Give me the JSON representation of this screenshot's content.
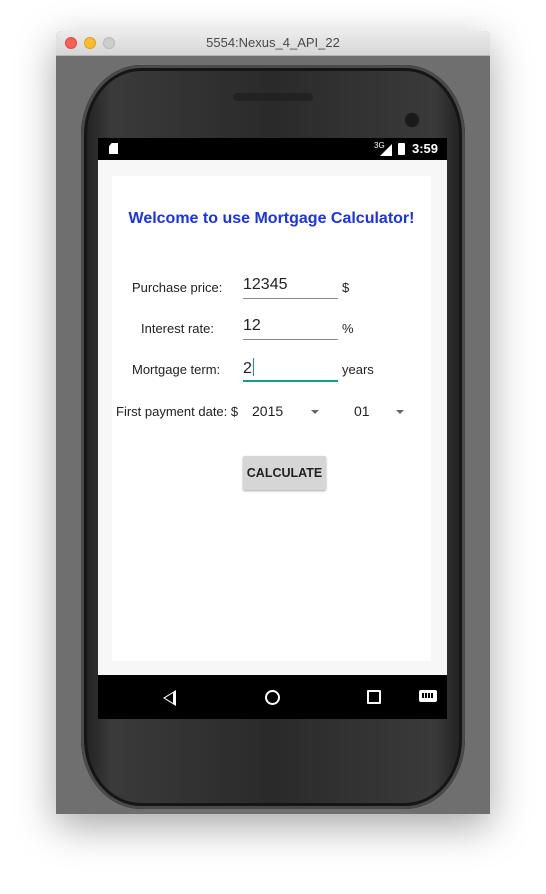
{
  "window": {
    "title": "5554:Nexus_4_API_22"
  },
  "statusbar": {
    "signal": "3G",
    "time": "3:59"
  },
  "app": {
    "heading": "Welcome to use Mortgage Calculator!",
    "purchase_price": {
      "label": "Purchase price:",
      "value": "12345",
      "unit": "$"
    },
    "interest_rate": {
      "label": "Interest rate:",
      "value": "12",
      "unit": "%"
    },
    "mortgage_term": {
      "label": "Mortgage term:",
      "value": "2",
      "unit": "years"
    },
    "first_payment": {
      "label": "First payment date: $",
      "year": "2015",
      "month": "01"
    },
    "calculate_label": "CALCULATE"
  },
  "navbar": {
    "icons": [
      "back-icon",
      "home-icon",
      "recents-icon",
      "keyboard-icon"
    ]
  },
  "colors": {
    "heading": "#1a33e8",
    "accent": "#139c8c",
    "button": "#d6d6d6"
  }
}
